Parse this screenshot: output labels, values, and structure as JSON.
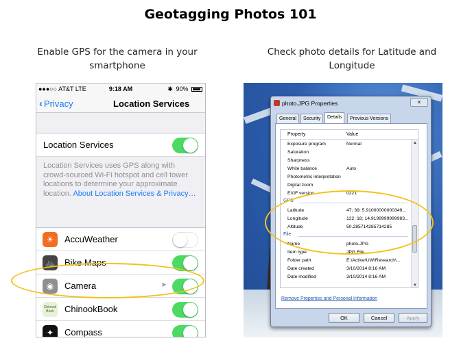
{
  "title": "Geotagging Photos 101",
  "captions": {
    "left": "Enable GPS for the camera in your smartphone",
    "right": "Check photo details for Latitude and Longitude"
  },
  "phone": {
    "status": {
      "carrier": "●●●○○ AT&T  LTE",
      "time": "9:18 AM",
      "battery": "90%"
    },
    "nav": {
      "back": "Privacy",
      "title": "Location Services"
    },
    "location_services_label": "Location Services",
    "location_services_on": true,
    "description": "Location Services uses GPS along with crowd-sourced Wi-Fi hotspot and cell tower locations to determine your approximate location.",
    "description_link": "About Location Services & Privacy…",
    "apps": [
      {
        "name": "AccuWeather",
        "icon": "sun-icon",
        "on": false
      },
      {
        "name": "Bike Maps",
        "icon": "bike-icon",
        "on": true
      },
      {
        "name": "Camera",
        "icon": "camera-icon",
        "on": true
      },
      {
        "name": "ChinookBook",
        "icon": "chinookbook-icon",
        "icon_text": "Chinook Book",
        "on": true
      },
      {
        "name": "Compass",
        "icon": "compass-icon",
        "on": true
      }
    ]
  },
  "dialog": {
    "title": "photo.JPG Properties",
    "close": "✕",
    "tabs": [
      "General",
      "Security",
      "Details",
      "Previous Versions"
    ],
    "active_tab": "Details",
    "columns": [
      "Property",
      "Value"
    ],
    "rows_top": [
      {
        "k": "Exposure program",
        "v": "Normal"
      },
      {
        "k": "Saturation",
        "v": ""
      },
      {
        "k": "Sharpness",
        "v": ""
      },
      {
        "k": "White balance",
        "v": "Auto"
      },
      {
        "k": "Photometric interpretation",
        "v": ""
      },
      {
        "k": "Digital zoom",
        "v": ""
      },
      {
        "k": "EXIF version",
        "v": "0221"
      }
    ],
    "gps_group": "GPS",
    "gps_rows": [
      {
        "k": "Latitude",
        "v": "47; 39; 5.91000000000349..."
      },
      {
        "k": "Longitude",
        "v": "122; 18; 14.9199999999983..."
      },
      {
        "k": "Altitude",
        "v": "50.285714285714285"
      }
    ],
    "file_group": "File",
    "file_rows": [
      {
        "k": "Name",
        "v": "photo.JPG"
      },
      {
        "k": "Item type",
        "v": "JPG File"
      },
      {
        "k": "Folder path",
        "v": "E:\\Active\\UW\\Research\\..."
      },
      {
        "k": "Date created",
        "v": "3/10/2014 8:16 AM"
      },
      {
        "k": "Date modified",
        "v": "3/10/2014 8:16 AM"
      }
    ],
    "remove_link": "Remove Properties and Personal Information",
    "buttons": {
      "ok": "OK",
      "cancel": "Cancel",
      "apply": "Apply"
    }
  },
  "colors": {
    "toggle_on": "#4cd964",
    "ios_blue": "#1a7cf5",
    "highlight": "#f2c21a"
  }
}
